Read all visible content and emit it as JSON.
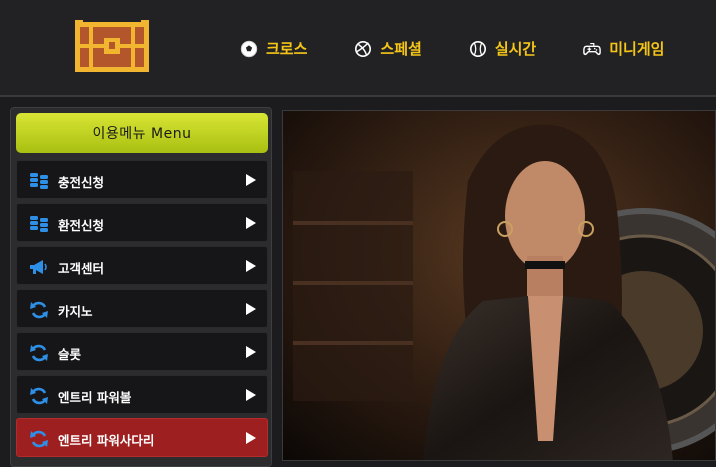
{
  "nav": {
    "items": [
      {
        "label": "크로스",
        "icon": "soccer-ball-icon"
      },
      {
        "label": "스페셜",
        "icon": "basketball-icon"
      },
      {
        "label": "실시간",
        "icon": "baseball-icon"
      },
      {
        "label": "미니게임",
        "icon": "controller-icon"
      }
    ]
  },
  "logo": {
    "icon": "treasure-chest-icon"
  },
  "sidebar": {
    "header": "이용메뉴   Menu",
    "items": [
      {
        "label": "충전신청",
        "icon": "coins-icon"
      },
      {
        "label": "환전신청",
        "icon": "coins-icon"
      },
      {
        "label": "고객센터",
        "icon": "megaphone-icon"
      },
      {
        "label": "카지노",
        "icon": "refresh-icon"
      },
      {
        "label": "슬롯",
        "icon": "refresh-icon"
      },
      {
        "label": "엔트리 파워볼",
        "icon": "refresh-icon"
      },
      {
        "label": "엔트리 파워사다리",
        "icon": "refresh-icon"
      }
    ],
    "active_index": 6
  },
  "colors": {
    "accent": "#f5c518",
    "menu_header": "#c8dc22",
    "active": "#9e1f1f",
    "icon_blue": "#2e8fe6"
  },
  "banner": {
    "subject": "casino-hostess-roulette-image"
  }
}
